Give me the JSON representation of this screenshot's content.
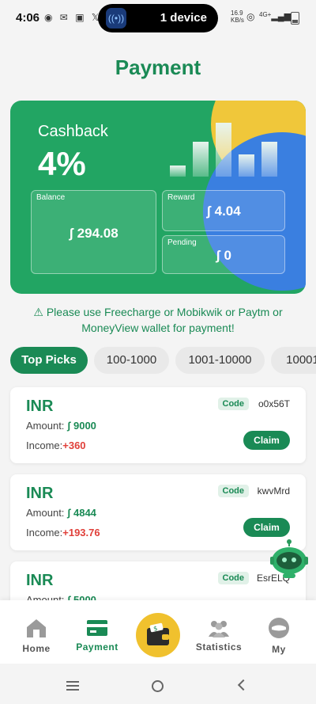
{
  "status_bar": {
    "time": "4:06",
    "left_icons": "◉ ✉ ▣ 𝕏",
    "pill_text": "1 device",
    "net_speed": "16.9",
    "net_unit": "KB/s",
    "network": "4G+"
  },
  "page": {
    "title": "Payment"
  },
  "card": {
    "cashback_label": "Cashback",
    "cashback_value": "4%",
    "balance_label": "Balance",
    "balance_value": "ʃ 294.08",
    "reward_label": "Reward",
    "reward_value": "ʃ 4.04",
    "pending_label": "Pending",
    "pending_value": "ʃ 0"
  },
  "notice": {
    "icon": "⚠",
    "text": "Please use Freecharge or Mobikwik or Paytm or MoneyView wallet for payment!"
  },
  "tabs": [
    {
      "label": "Top Picks",
      "active": true
    },
    {
      "label": "100-1000",
      "active": false
    },
    {
      "label": "1001-10000",
      "active": false
    },
    {
      "label": "10001",
      "active": false
    }
  ],
  "offer_labels": {
    "amount_label": "Amount:",
    "income_label": "Income:",
    "code_label": "Code",
    "claim_label": "Claim"
  },
  "offers": [
    {
      "currency": "INR",
      "amount": "ʃ 9000",
      "income": "+360",
      "code": "o0x56T"
    },
    {
      "currency": "INR",
      "amount": "ʃ 4844",
      "income": "+193.76",
      "code": "kwvMrd"
    },
    {
      "currency": "INR",
      "amount": "ʃ 5000",
      "income": "",
      "code": "EsrELQ"
    }
  ],
  "bottom_nav": [
    {
      "label": "Home",
      "icon": "home-icon",
      "active": false
    },
    {
      "label": "Payment",
      "icon": "card-icon",
      "active": true
    },
    {
      "label": "",
      "icon": "wallet-icon",
      "active": false
    },
    {
      "label": "Statistics",
      "icon": "people-icon",
      "active": false
    },
    {
      "label": "My",
      "icon": "profile-icon",
      "active": false
    }
  ],
  "colors": {
    "brand_green": "#1a8a55",
    "card_green": "#22a563",
    "income_red": "#e0403a",
    "wallet_yellow": "#f0c12e"
  }
}
